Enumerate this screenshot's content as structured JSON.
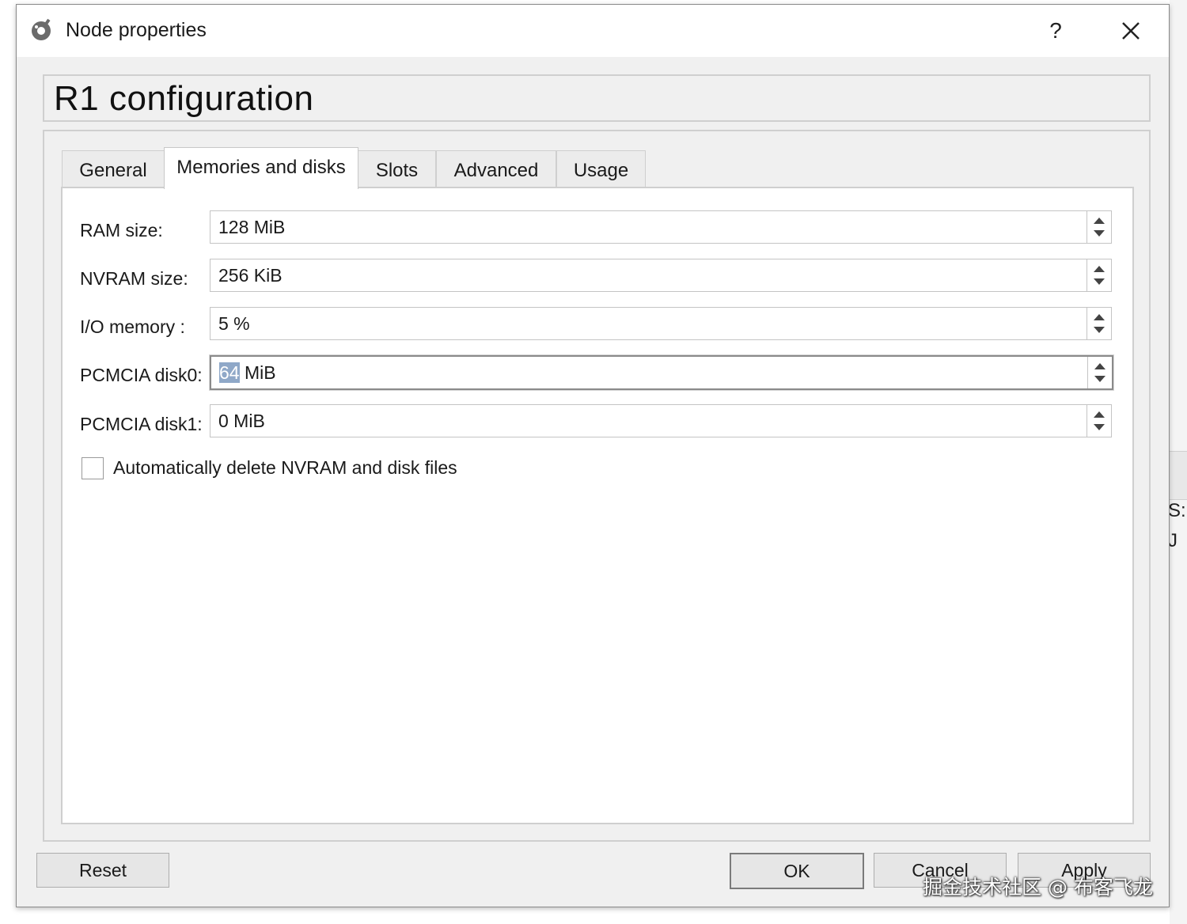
{
  "window": {
    "title": "Node properties",
    "help_label": "?"
  },
  "header": {
    "title": "R1 configuration"
  },
  "tabs": [
    {
      "label": "General",
      "active": false
    },
    {
      "label": "Memories and disks",
      "active": true
    },
    {
      "label": "Slots",
      "active": false
    },
    {
      "label": "Advanced",
      "active": false
    },
    {
      "label": "Usage",
      "active": false
    }
  ],
  "fields": {
    "ram": {
      "label": "RAM size:",
      "value": "128 MiB"
    },
    "nvram": {
      "label": "NVRAM size:",
      "value": "256 KiB"
    },
    "io_memory": {
      "label": "I/O memory :",
      "value": "5 %"
    },
    "disk0": {
      "label": "PCMCIA disk0:",
      "value_selected": "64",
      "value_rest": " MiB"
    },
    "disk1": {
      "label": "PCMCIA disk1:",
      "value": "0 MiB"
    }
  },
  "auto_delete": {
    "label": "Automatically delete NVRAM and disk files",
    "checked": false
  },
  "buttons": {
    "reset": "Reset",
    "ok": "OK",
    "cancel": "Cancel",
    "apply": "Apply"
  },
  "background": {
    "text_1": "S:",
    "text_2": "J"
  },
  "watermark": "掘金技术社区 @ 布客飞龙",
  "colors": {
    "window_bg": "#f0f0f0",
    "selection": "#8fa8c8"
  }
}
